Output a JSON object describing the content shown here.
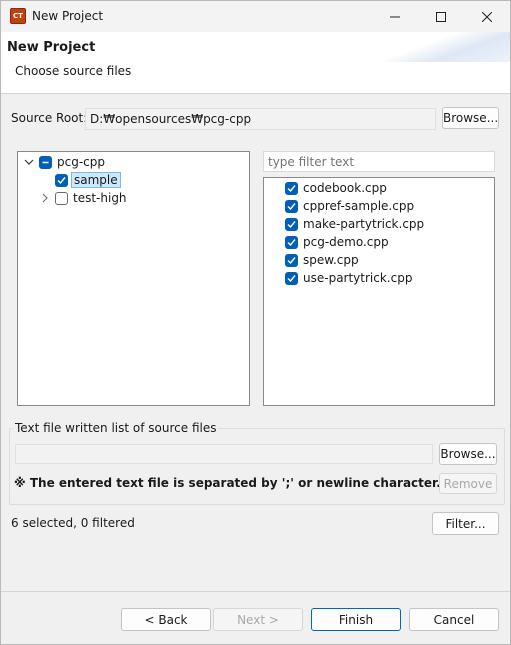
{
  "window": {
    "app_icon_text": "CT",
    "title": "New Project"
  },
  "header": {
    "title": "New Project",
    "subtitle": "Choose source files"
  },
  "source_root": {
    "label": "Source Root:",
    "value": "D:₩opensources₩pcg-cpp",
    "browse_label": "Browse..."
  },
  "tree": {
    "items": [
      {
        "label": "pcg-cpp",
        "state": "partial",
        "expanded": true
      },
      {
        "label": "sample",
        "state": "checked",
        "selected": true
      },
      {
        "label": "test-high",
        "state": "unchecked",
        "expanded": false
      }
    ]
  },
  "files": {
    "filter_placeholder": "type filter text",
    "items": [
      {
        "label": "codebook.cpp",
        "checked": true
      },
      {
        "label": "cppref-sample.cpp",
        "checked": true
      },
      {
        "label": "make-partytrick.cpp",
        "checked": true
      },
      {
        "label": "pcg-demo.cpp",
        "checked": true
      },
      {
        "label": "spew.cpp",
        "checked": true
      },
      {
        "label": "use-partytrick.cpp",
        "checked": true
      }
    ]
  },
  "text_file_group": {
    "legend": "Text file written list of source files",
    "value": "",
    "browse_label": "Browse...",
    "remove_label": "Remove",
    "note": "※ The entered text file is separated by ';' or newline character."
  },
  "status": {
    "summary": "6 selected, 0 filtered",
    "filter_button": "Filter..."
  },
  "footer": {
    "back_label": "< Back",
    "next_label": "Next >",
    "finish_label": "Finish",
    "cancel_label": "Cancel"
  },
  "colors": {
    "accent": "#005fb8",
    "selection": "#cce8ff"
  }
}
